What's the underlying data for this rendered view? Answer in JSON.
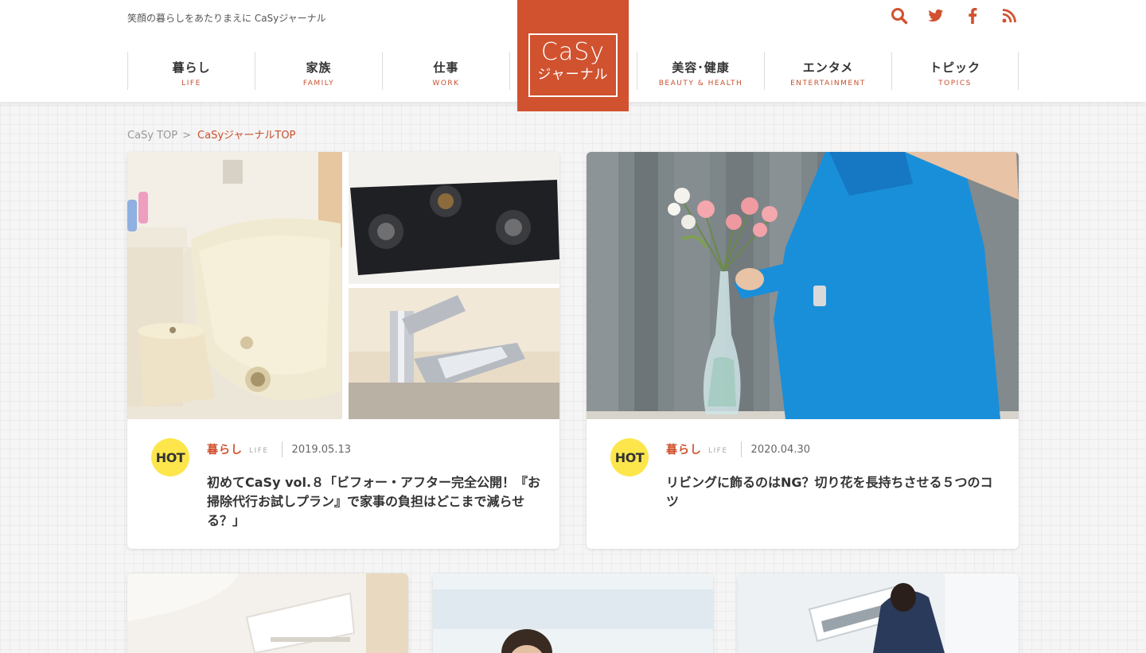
{
  "header": {
    "tagline": "笑顔の暮らしをあたりまえに CaSyジャーナル",
    "logo": {
      "line1": "CaSy",
      "line2": "ジャーナル"
    },
    "social_icons": [
      "search-icon",
      "twitter-icon",
      "facebook-icon",
      "rss-icon"
    ],
    "nav": [
      {
        "ja": "暮らし",
        "en": "LIFE"
      },
      {
        "ja": "家族",
        "en": "FAMILY"
      },
      {
        "ja": "仕事",
        "en": "WORK"
      },
      {
        "ja": "美容･健康",
        "en": "BEAUTY & HEALTH"
      },
      {
        "ja": "エンタメ",
        "en": "ENTERTAINMENT"
      },
      {
        "ja": "トピック",
        "en": "TOPICS"
      }
    ]
  },
  "breadcrumb": {
    "home": "CaSy TOP",
    "separator": ">",
    "current": "CaSyジャーナルTOP"
  },
  "articles": [
    {
      "badge": "HOT",
      "category_ja": "暮らし",
      "category_en": "LIFE",
      "date": "2019.05.13",
      "title": "初めてCaSy vol.８「ビフォー・アフター完全公開！『お掃除代行お試しプラン』で家事の負担はどこまで減らせる？」"
    },
    {
      "badge": "HOT",
      "category_ja": "暮らし",
      "category_en": "LIFE",
      "date": "2020.04.30",
      "title": "リビングに飾るのはNG？切り花を長持ちさせる５つのコツ"
    }
  ],
  "colors": {
    "accent": "#d0522f",
    "hot_badge": "#fde64b",
    "sweater": "#1a8fd9"
  }
}
